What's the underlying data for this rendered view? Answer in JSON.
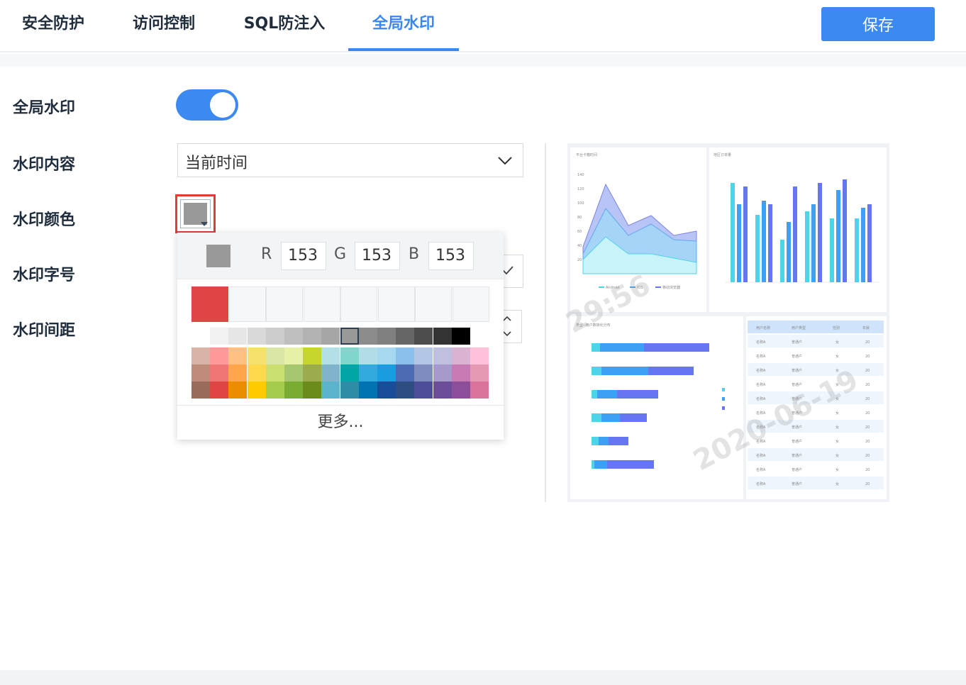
{
  "tabs": [
    {
      "label": "安全防护",
      "active": false
    },
    {
      "label": "访问控制",
      "active": false
    },
    {
      "label": "SQL防注入",
      "active": false
    },
    {
      "label": "全局水印",
      "active": true
    }
  ],
  "toolbar": {
    "save_label": "保存"
  },
  "form": {
    "watermark_label": "全局水印",
    "watermark_enabled": true,
    "content_label": "水印内容",
    "content_value": "当前时间",
    "color_label": "水印颜色",
    "font_size_label": "水印字号",
    "spacing_label": "水印间距"
  },
  "color_picker": {
    "current_color": "#999999",
    "r_label": "R",
    "r_value": "153",
    "g_label": "G",
    "g_value": "153",
    "b_label": "B",
    "b_value": "153",
    "recent_colors": [
      "#e04545",
      "",
      "",
      "",
      "",
      "",
      "",
      ""
    ],
    "more_label": "更多...",
    "palette": [
      [
        "#ffffff",
        "#f2f2f2",
        "#e6e6e6",
        "#d9d9d9",
        "#cccccc",
        "#bfbfbf",
        "#b3b3b3",
        "#a6a6a6",
        "#999999",
        "#8c8c8c",
        "#808080",
        "#666666",
        "#4d4d4d",
        "#333333",
        "#000000"
      ],
      [
        "#d9b3a6",
        "#ff9999",
        "#ffc080",
        "#f5e16b",
        "#d9e6a6",
        "#e6f0a6",
        "#c7d62b",
        "#b3e0e6",
        "#80d6cc",
        "#b3dde6",
        "#a6d9f0",
        "#8cc0ec",
        "#b3c6e6",
        "#bfbfe0",
        "#d9b3d1",
        "#ffc0d9"
      ],
      [
        "#bf8c7a",
        "#f07575",
        "#ffa64d",
        "#ffd94d",
        "#c9e070",
        "#a6c770",
        "#9bab4d",
        "#80b3cc",
        "#00a6a6",
        "#33aadd",
        "#1a9de0",
        "#4d6bb3",
        "#7f8cc0",
        "#a699cc",
        "#c77ab3",
        "#e699b3"
      ],
      [
        "#996b59",
        "#e04545",
        "#ec8c00",
        "#ffcc00",
        "#a6cc4d",
        "#7aab33",
        "#6b8c1a",
        "#5cb3cc",
        "#2e8ca6",
        "#0073b3",
        "#1a4d99",
        "#2e4d80",
        "#4d4d99",
        "#6b4d99",
        "#8c4d99",
        "#d9739c"
      ]
    ],
    "selected_swatch": "#999999"
  },
  "preview": {
    "area_chart_title": "平台卡箱时间",
    "bar_chart_title": "地区订单量",
    "hbar_chart_title": "类型--用户数转化分布",
    "legend_a": "Android",
    "legend_b": "IOS",
    "legend_c": "移动浏览器",
    "watermark_text_1": "29:56",
    "watermark_text_2": "2020-06-19",
    "table_headers": [
      "用户名称",
      "用户类型",
      "性别",
      "年龄"
    ],
    "table_row": [
      "名称A",
      "普通户",
      "女",
      "20"
    ]
  }
}
